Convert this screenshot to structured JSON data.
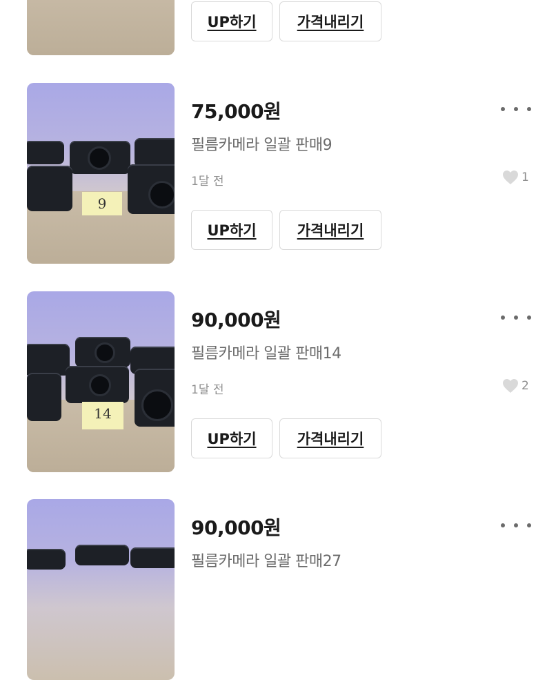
{
  "buttons": {
    "up_label": "UP하기",
    "price_down_label": "가격내리기"
  },
  "items": [
    {
      "price": "",
      "title": "",
      "time": "",
      "likes": "",
      "note": ""
    },
    {
      "price": "75,000원",
      "title": "필름카메라 일괄 판매9",
      "time": "1달 전",
      "likes": "1",
      "note": "9"
    },
    {
      "price": "90,000원",
      "title": "필름카메라 일괄 판매14",
      "time": "1달 전",
      "likes": "2",
      "note": "14"
    },
    {
      "price": "90,000원",
      "title": "필름카메라 일괄 판매27",
      "time": "",
      "likes": "",
      "note": ""
    }
  ],
  "colors": {
    "heart": "#d9d9d9",
    "text_primary": "#1a1a1a",
    "text_secondary": "#6b6b6b",
    "border": "#d9d9d9"
  },
  "icons": {
    "more": "more-dots-icon",
    "like": "heart-icon"
  }
}
